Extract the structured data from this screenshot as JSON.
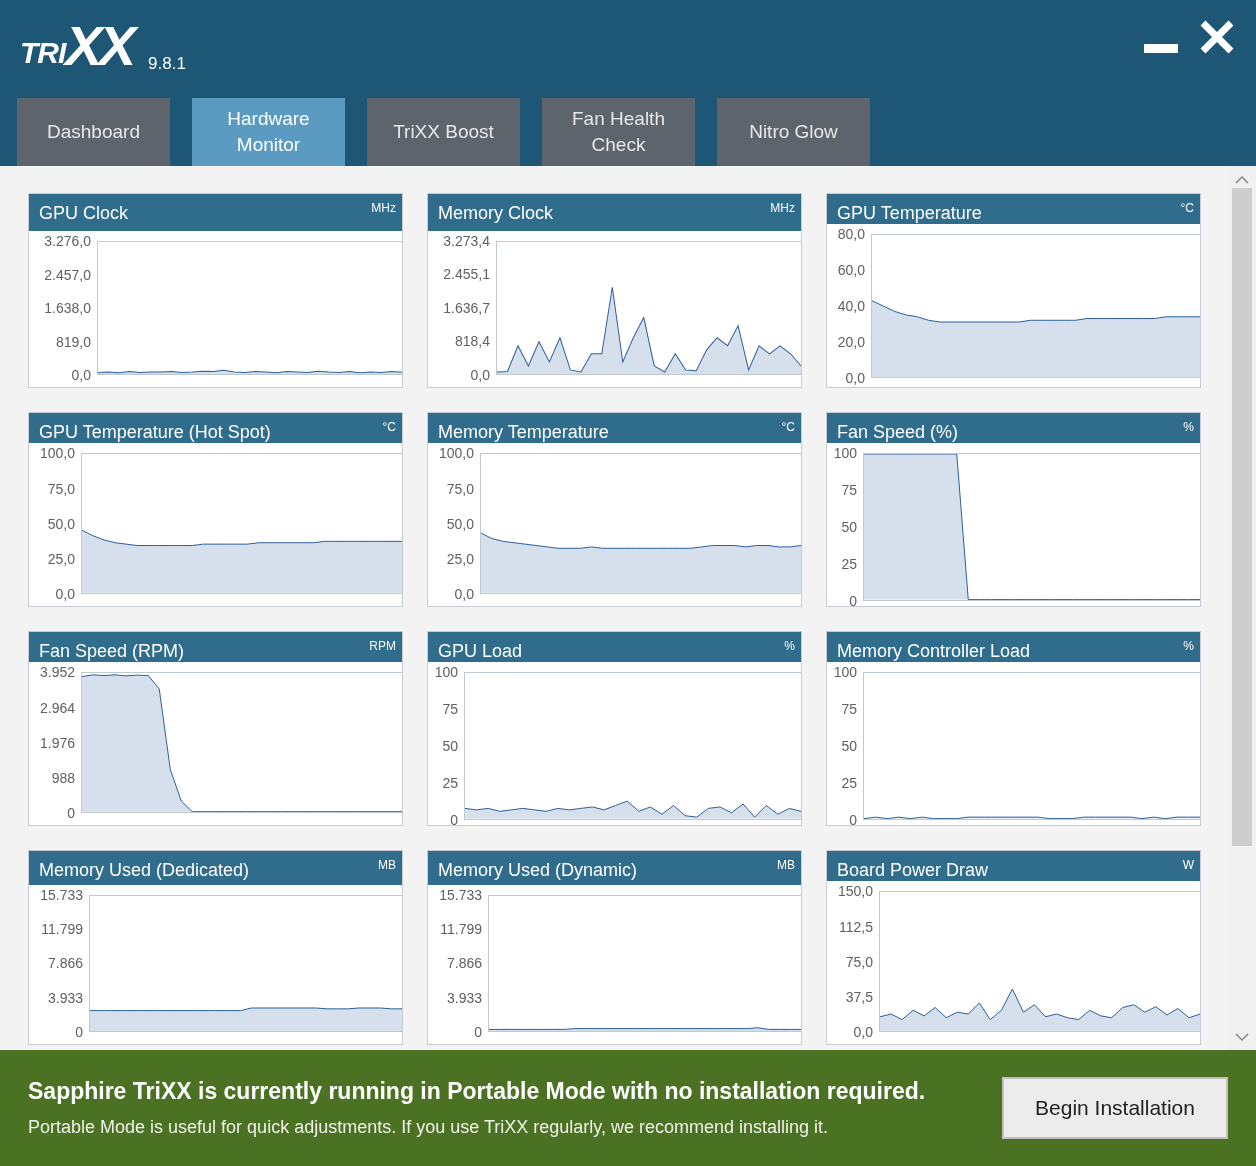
{
  "app": {
    "logo": {
      "prefix": "TRI",
      "mark": "XX"
    },
    "version": "9.8.1"
  },
  "tabs": [
    {
      "label": "Dashboard",
      "selected": false
    },
    {
      "label": "Hardware Monitor",
      "selected": true
    },
    {
      "label": "TriXX Boost",
      "selected": false
    },
    {
      "label": "Fan Health Check",
      "selected": false
    },
    {
      "label": "Nitro Glow",
      "selected": false
    }
  ],
  "monitors": [
    {
      "title": "GPU Clock",
      "unit": "MHz",
      "chart_data": {
        "type": "area",
        "ylim": [
          0,
          3276
        ],
        "yticks": [
          {
            "value": 3276,
            "label": "3.276,0"
          },
          {
            "value": 2457,
            "label": "2.457,0"
          },
          {
            "value": 1638,
            "label": "1.638,0"
          },
          {
            "value": 819,
            "label": "819,0"
          },
          {
            "value": 0,
            "label": "0,0"
          }
        ],
        "values": [
          40,
          50,
          30,
          60,
          40,
          50,
          50,
          60,
          40,
          50,
          70,
          60,
          90,
          50,
          40,
          60,
          50,
          30,
          60,
          50,
          40,
          70,
          50,
          40,
          60,
          30,
          50,
          40,
          60,
          40
        ]
      }
    },
    {
      "title": "Memory Clock",
      "unit": "MHz",
      "chart_data": {
        "type": "area",
        "ylim": [
          0,
          3273.4
        ],
        "yticks": [
          {
            "value": 3273.4,
            "label": "3.273,4"
          },
          {
            "value": 2455.1,
            "label": "2.455,1"
          },
          {
            "value": 1636.7,
            "label": "1.636,7"
          },
          {
            "value": 818.4,
            "label": "818,4"
          },
          {
            "value": 0,
            "label": "0,0"
          }
        ],
        "values": [
          50,
          60,
          700,
          200,
          800,
          300,
          900,
          100,
          50,
          500,
          500,
          2150,
          300,
          900,
          1400,
          200,
          50,
          500,
          100,
          80,
          600,
          900,
          700,
          1200,
          100,
          700,
          500,
          700,
          500,
          200
        ]
      }
    },
    {
      "title": "GPU Temperature",
      "unit": "°C",
      "chart_data": {
        "type": "area",
        "ylim": [
          0,
          80
        ],
        "yticks": [
          {
            "value": 80,
            "label": "80,0"
          },
          {
            "value": 60,
            "label": "60,0"
          },
          {
            "value": 40,
            "label": "40,0"
          },
          {
            "value": 20,
            "label": "20,0"
          },
          {
            "value": 0,
            "label": "0,0"
          }
        ],
        "values": [
          43,
          40,
          37,
          35,
          34,
          32,
          31,
          31,
          31,
          31,
          31,
          31,
          31,
          31,
          32,
          32,
          32,
          32,
          32,
          33,
          33,
          33,
          33,
          33,
          33,
          33,
          34,
          34,
          34,
          34
        ]
      }
    },
    {
      "title": "GPU Temperature (Hot Spot)",
      "unit": "°C",
      "chart_data": {
        "type": "area",
        "ylim": [
          0,
          100
        ],
        "yticks": [
          {
            "value": 100,
            "label": "100,0"
          },
          {
            "value": 75,
            "label": "75,0"
          },
          {
            "value": 50,
            "label": "50,0"
          },
          {
            "value": 25,
            "label": "25,0"
          },
          {
            "value": 0,
            "label": "0,0"
          }
        ],
        "values": [
          45,
          41,
          38,
          36,
          35,
          34,
          34,
          34,
          34,
          34,
          34,
          35,
          35,
          35,
          35,
          35,
          36,
          36,
          36,
          36,
          36,
          36,
          37,
          37,
          37,
          37,
          37,
          37,
          37,
          37
        ]
      }
    },
    {
      "title": "Memory Temperature",
      "unit": "°C",
      "chart_data": {
        "type": "area",
        "ylim": [
          0,
          100
        ],
        "yticks": [
          {
            "value": 100,
            "label": "100,0"
          },
          {
            "value": 75,
            "label": "75,0"
          },
          {
            "value": 50,
            "label": "50,0"
          },
          {
            "value": 25,
            "label": "25,0"
          },
          {
            "value": 0,
            "label": "0,0"
          }
        ],
        "values": [
          43,
          39,
          37,
          36,
          35,
          34,
          33,
          32,
          32,
          32,
          33,
          32,
          32,
          32,
          32,
          32,
          32,
          32,
          32,
          32,
          33,
          34,
          34,
          34,
          33,
          34,
          34,
          33,
          33,
          34
        ]
      }
    },
    {
      "title": "Fan Speed (%)",
      "unit": "%",
      "chart_data": {
        "type": "area",
        "ylim": [
          0,
          100
        ],
        "yticks": [
          {
            "value": 100,
            "label": "100"
          },
          {
            "value": 75,
            "label": "75"
          },
          {
            "value": 50,
            "label": "50"
          },
          {
            "value": 25,
            "label": "25"
          },
          {
            "value": 0,
            "label": "0"
          }
        ],
        "values": [
          100,
          100,
          100,
          100,
          100,
          100,
          100,
          100,
          100,
          0,
          0,
          0,
          0,
          0,
          0,
          0,
          0,
          0,
          0,
          0,
          0,
          0,
          0,
          0,
          0,
          0,
          0,
          0,
          0,
          0
        ]
      }
    },
    {
      "title": "Fan Speed (RPM)",
      "unit": "RPM",
      "chart_data": {
        "type": "area",
        "ylim": [
          0,
          3952
        ],
        "yticks": [
          {
            "value": 3952,
            "label": "3.952"
          },
          {
            "value": 2964,
            "label": "2.964"
          },
          {
            "value": 1976,
            "label": "1.976"
          },
          {
            "value": 988,
            "label": "988"
          },
          {
            "value": 0,
            "label": "0"
          }
        ],
        "values": [
          3850,
          3900,
          3880,
          3900,
          3870,
          3890,
          3880,
          3500,
          1200,
          300,
          0,
          0,
          0,
          0,
          0,
          0,
          0,
          0,
          0,
          0,
          0,
          0,
          0,
          0,
          0,
          0,
          0,
          0,
          0,
          0
        ]
      }
    },
    {
      "title": "GPU Load",
      "unit": "%",
      "chart_data": {
        "type": "area",
        "ylim": [
          0,
          100
        ],
        "yticks": [
          {
            "value": 100,
            "label": "100"
          },
          {
            "value": 75,
            "label": "75"
          },
          {
            "value": 50,
            "label": "50"
          },
          {
            "value": 25,
            "label": "25"
          },
          {
            "value": 0,
            "label": "0"
          }
        ],
        "values": [
          7,
          6,
          7,
          5,
          6,
          7,
          6,
          5,
          7,
          6,
          7,
          8,
          6,
          9,
          12,
          5,
          8,
          3,
          9,
          2,
          1,
          7,
          8,
          4,
          10,
          1,
          9,
          3,
          7,
          5
        ]
      }
    },
    {
      "title": "Memory Controller Load",
      "unit": "%",
      "chart_data": {
        "type": "area",
        "ylim": [
          0,
          100
        ],
        "yticks": [
          {
            "value": 100,
            "label": "100"
          },
          {
            "value": 75,
            "label": "75"
          },
          {
            "value": 50,
            "label": "50"
          },
          {
            "value": 25,
            "label": "25"
          },
          {
            "value": 0,
            "label": "0"
          }
        ],
        "values": [
          0,
          1,
          0,
          1,
          0,
          1,
          0,
          0,
          0,
          1,
          1,
          1,
          1,
          1,
          1,
          1,
          0,
          0,
          0,
          1,
          1,
          1,
          1,
          1,
          0,
          1,
          0,
          1,
          1,
          1
        ]
      }
    },
    {
      "title": "Memory Used (Dedicated)",
      "unit": "MB",
      "chart_data": {
        "type": "area",
        "ylim": [
          0,
          15733
        ],
        "yticks": [
          {
            "value": 15733,
            "label": "15.733"
          },
          {
            "value": 11799,
            "label": "11.799"
          },
          {
            "value": 7866,
            "label": "7.866"
          },
          {
            "value": 3933,
            "label": "3.933"
          },
          {
            "value": 0,
            "label": "0"
          }
        ],
        "values": [
          2400,
          2400,
          2400,
          2400,
          2400,
          2400,
          2400,
          2400,
          2400,
          2400,
          2400,
          2400,
          2400,
          2400,
          2400,
          2700,
          2700,
          2700,
          2700,
          2700,
          2700,
          2700,
          2600,
          2600,
          2600,
          2700,
          2700,
          2700,
          2600,
          2600
        ]
      }
    },
    {
      "title": "Memory Used (Dynamic)",
      "unit": "MB",
      "chart_data": {
        "type": "area",
        "ylim": [
          0,
          15733
        ],
        "yticks": [
          {
            "value": 15733,
            "label": "15.733"
          },
          {
            "value": 11799,
            "label": "11.799"
          },
          {
            "value": 7866,
            "label": "7.866"
          },
          {
            "value": 3933,
            "label": "3.933"
          },
          {
            "value": 0,
            "label": "0"
          }
        ],
        "values": [
          200,
          200,
          200,
          200,
          200,
          200,
          200,
          200,
          300,
          300,
          300,
          300,
          300,
          300,
          300,
          300,
          300,
          300,
          300,
          300,
          300,
          300,
          300,
          300,
          300,
          400,
          200,
          200,
          200,
          200
        ]
      }
    },
    {
      "title": "Board Power Draw",
      "unit": "W",
      "chart_data": {
        "type": "area",
        "ylim": [
          0,
          150
        ],
        "yticks": [
          {
            "value": 150,
            "label": "150,0"
          },
          {
            "value": 112.5,
            "label": "112,5"
          },
          {
            "value": 75,
            "label": "75,0"
          },
          {
            "value": 37.5,
            "label": "37,5"
          },
          {
            "value": 0,
            "label": "0,0"
          }
        ],
        "values": [
          15,
          18,
          12,
          22,
          16,
          25,
          14,
          20,
          18,
          30,
          12,
          22,
          45,
          20,
          28,
          15,
          18,
          14,
          12,
          22,
          16,
          14,
          25,
          28,
          20,
          26,
          17,
          24,
          14,
          18
        ]
      }
    }
  ],
  "banner": {
    "title": "Sapphire TriXX is currently running in Portable Mode with no installation required.",
    "text": "Portable Mode is useful for quick adjustments. If you use TriXX regularly, we recommend installing it.",
    "button": "Begin Installation"
  }
}
